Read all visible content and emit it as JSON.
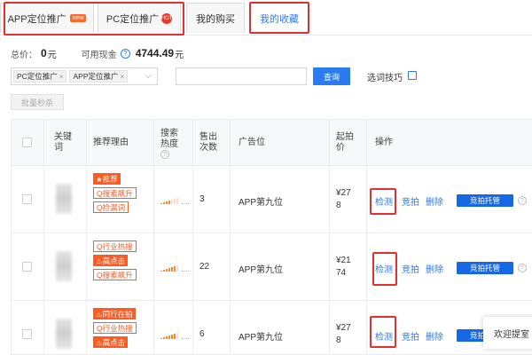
{
  "tabs": [
    {
      "label": "APP定位推广",
      "badge": "new"
    },
    {
      "label": "PC定位推广",
      "badge": "HOT"
    },
    {
      "label": "我的购买"
    },
    {
      "label": "我的收藏"
    }
  ],
  "summary": {
    "total_label": "总价：",
    "total_value": "0",
    "total_unit": "元",
    "cash_label": "可用现金",
    "cash_help": "?",
    "cash_value": "4744.49",
    "cash_unit": "元"
  },
  "filters": {
    "chips": [
      "PC定位推广",
      "APP定位推广"
    ],
    "chip_remove": "×",
    "chevron": "⌵",
    "search_value": "",
    "search_button": "查询",
    "tips_label": "选词技巧"
  },
  "batch_button": "批量秒杀",
  "table": {
    "headers": [
      "关键\n词",
      "推荐理由",
      "搜索\n热度",
      "售出\n次数",
      "广告位",
      "起拍\n价",
      "操作"
    ],
    "heat_help": "?",
    "rows": [
      {
        "tags": [
          {
            "text": "★推荐",
            "style": "filled"
          },
          {
            "text": "Q搜索飙升",
            "style": "outline"
          },
          {
            "text": "Q捡漏词",
            "style": "outline"
          }
        ],
        "heat": 0.6,
        "sold": "3",
        "slot": "APP第九位",
        "price_line1": "¥27",
        "price_line2": "8",
        "actions": [
          "检测",
          "竞拍",
          "删除"
        ],
        "managed": "竞拍托管"
      },
      {
        "tags": [
          {
            "text": "Q行业热搜",
            "style": "outline"
          },
          {
            "text": "♨高点击",
            "style": "filled"
          },
          {
            "text": "Q搜索飙升",
            "style": "outline"
          }
        ],
        "heat": 0.9,
        "sold": "22",
        "slot": "APP第九位",
        "price_line1": "¥21",
        "price_line2": "74",
        "actions": [
          "检测",
          "竞拍",
          "删除"
        ],
        "managed": "竞拍托管"
      },
      {
        "tags": [
          {
            "text": "♨同行在拍",
            "style": "filled"
          },
          {
            "text": "Q行业热搜",
            "style": "outline"
          },
          {
            "text": "♨高点击",
            "style": "filled"
          }
        ],
        "heat": 0.8,
        "sold": "6",
        "slot": "APP第九位",
        "price_line1": "¥27",
        "price_line2": "8",
        "actions": [
          "检测",
          "竞拍",
          "删除"
        ],
        "managed": "竞拍托管"
      }
    ]
  },
  "toast": "欢迎提室",
  "colors": {
    "accent": "#2b7bf0",
    "tag": "#ff5a1f",
    "highlight": "#e52e2e"
  }
}
